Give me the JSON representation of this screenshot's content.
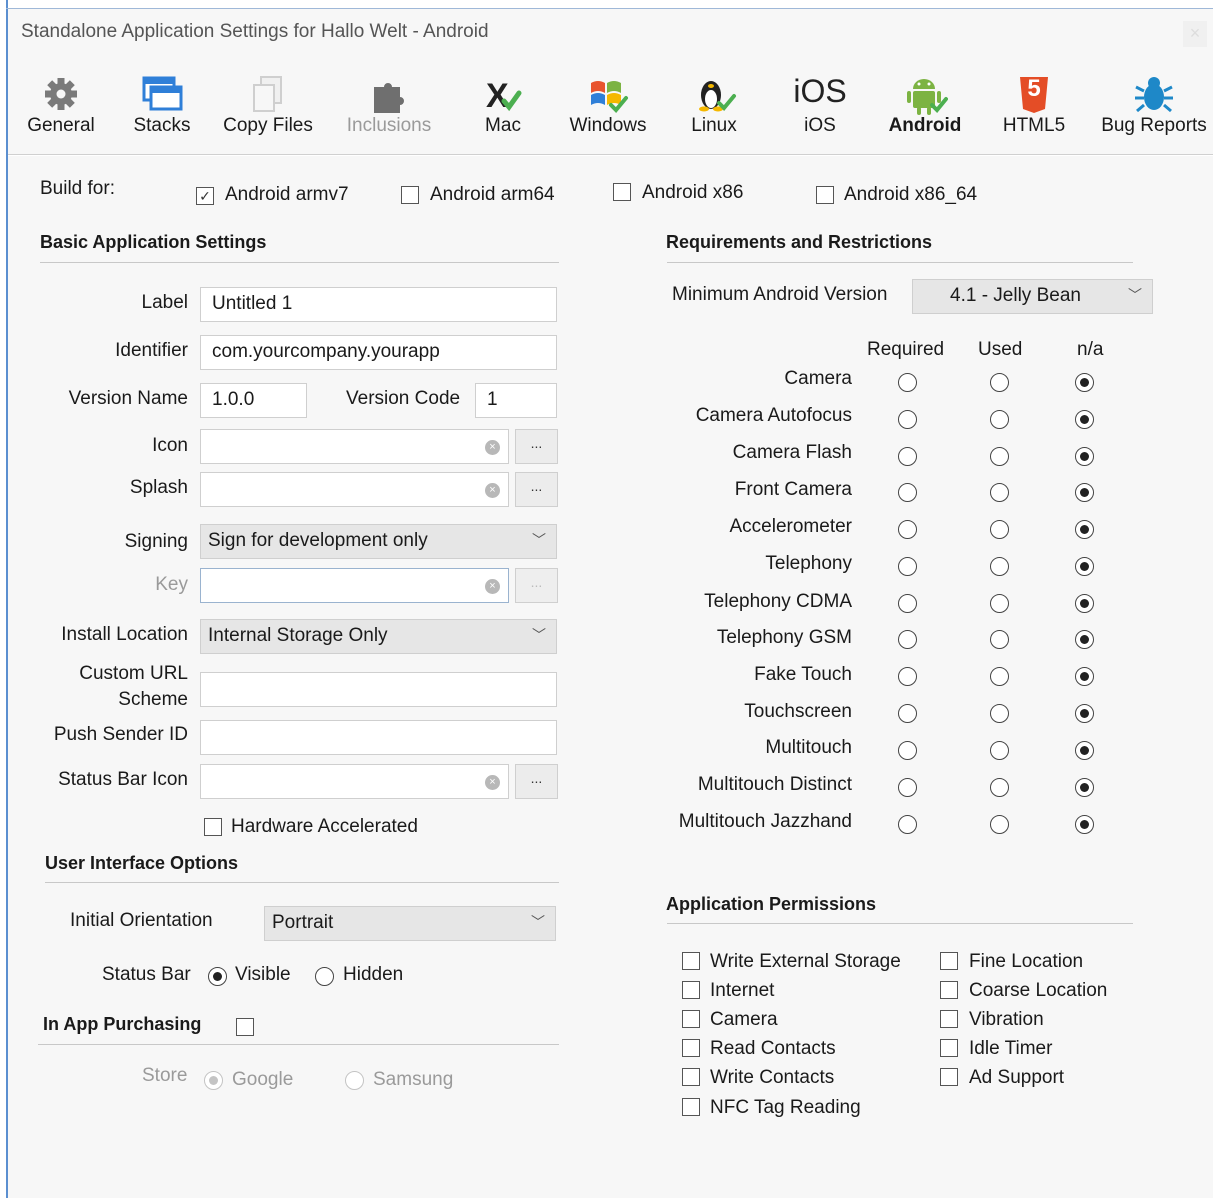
{
  "window": {
    "title": "Standalone Application Settings for Hallo Welt - Android",
    "close": "×"
  },
  "toolbar": {
    "items": [
      {
        "label": "General",
        "icon": "gear-icon"
      },
      {
        "label": "Stacks",
        "icon": "stacks-icon"
      },
      {
        "label": "Copy Files",
        "icon": "copy-files-icon"
      },
      {
        "label": "Inclusions",
        "icon": "puzzle-icon"
      },
      {
        "label": "Mac",
        "icon": "mac-icon"
      },
      {
        "label": "Windows",
        "icon": "windows-icon"
      },
      {
        "label": "Linux",
        "icon": "linux-icon"
      },
      {
        "label": "iOS",
        "icon": "ios-icon",
        "icon_text": "iOS"
      },
      {
        "label": "Android",
        "icon": "android-icon"
      },
      {
        "label": "HTML5",
        "icon": "html5-icon",
        "icon_text": "5"
      },
      {
        "label": "Bug Reports",
        "icon": "bug-icon"
      }
    ],
    "active": "Android"
  },
  "build_for": {
    "label": "Build for:",
    "options": [
      {
        "label": "Android armv7",
        "checked": true
      },
      {
        "label": "Android arm64",
        "checked": false
      },
      {
        "label": "Android x86",
        "checked": false
      },
      {
        "label": "Android x86_64",
        "checked": false
      }
    ]
  },
  "basic": {
    "heading": "Basic Application Settings",
    "label_label": "Label",
    "label_value": "Untitled 1",
    "identifier_label": "Identifier",
    "identifier_value": "com.yourcompany.yourapp",
    "version_name_label": "Version Name",
    "version_name_value": "1.0.0",
    "version_code_label": "Version Code",
    "version_code_value": "1",
    "icon_label": "Icon",
    "icon_value": "",
    "splash_label": "Splash",
    "splash_value": "",
    "browse_label": "...",
    "signing_label": "Signing",
    "signing_value": "Sign for development only",
    "key_label": "Key",
    "key_value": "",
    "install_location_label": "Install Location",
    "install_location_value": "Internal Storage Only",
    "custom_url_label_1": "Custom URL",
    "custom_url_label_2": "Scheme",
    "custom_url_value": "",
    "push_sender_label": "Push Sender ID",
    "push_sender_value": "",
    "status_bar_icon_label": "Status Bar Icon",
    "status_bar_icon_value": "",
    "hardware_accelerated_label": "Hardware Accelerated",
    "hardware_accelerated": false
  },
  "ui_options": {
    "heading": "User Interface Options",
    "orientation_label": "Initial Orientation",
    "orientation_value": "Portrait",
    "status_bar_label": "Status Bar",
    "status_bar_visible": "Visible",
    "status_bar_hidden": "Hidden",
    "status_bar_selected": "Visible"
  },
  "iap": {
    "heading": "In App Purchasing",
    "enabled": false,
    "store_label": "Store",
    "store_google": "Google",
    "store_samsung": "Samsung",
    "store_selected": "Google"
  },
  "requirements": {
    "heading": "Requirements and Restrictions",
    "min_version_label": "Minimum Android Version",
    "min_version_value": "4.1 - Jelly Bean",
    "col_required": "Required",
    "col_used": "Used",
    "col_na": "n/a",
    "features": [
      {
        "name": "Camera",
        "value": "n/a"
      },
      {
        "name": "Camera Autofocus",
        "value": "n/a"
      },
      {
        "name": "Camera Flash",
        "value": "n/a"
      },
      {
        "name": "Front Camera",
        "value": "n/a"
      },
      {
        "name": "Accelerometer",
        "value": "n/a"
      },
      {
        "name": "Telephony",
        "value": "n/a"
      },
      {
        "name": "Telephony CDMA",
        "value": "n/a"
      },
      {
        "name": "Telephony GSM",
        "value": "n/a"
      },
      {
        "name": "Fake Touch",
        "value": "n/a"
      },
      {
        "name": "Touchscreen",
        "value": "n/a"
      },
      {
        "name": "Multitouch",
        "value": "n/a"
      },
      {
        "name": "Multitouch Distinct",
        "value": "n/a"
      },
      {
        "name": "Multitouch Jazzhand",
        "value": "n/a"
      }
    ]
  },
  "permissions": {
    "heading": "Application Permissions",
    "left": [
      {
        "label": "Write External Storage",
        "checked": false
      },
      {
        "label": "Internet",
        "checked": false
      },
      {
        "label": "Camera",
        "checked": false
      },
      {
        "label": "Read Contacts",
        "checked": false
      },
      {
        "label": "Write Contacts",
        "checked": false
      },
      {
        "label": "NFC Tag Reading",
        "checked": false
      }
    ],
    "right": [
      {
        "label": "Fine Location",
        "checked": false
      },
      {
        "label": "Coarse Location",
        "checked": false
      },
      {
        "label": "Vibration",
        "checked": false
      },
      {
        "label": "Idle Timer",
        "checked": false
      },
      {
        "label": "Ad Support",
        "checked": false
      }
    ]
  },
  "colors": {
    "window_border": "#5b8fd0",
    "html5": "#e44d26",
    "android": "#7cb342",
    "mac_check": "#4caf50",
    "stacks": "#2f7fd8"
  }
}
